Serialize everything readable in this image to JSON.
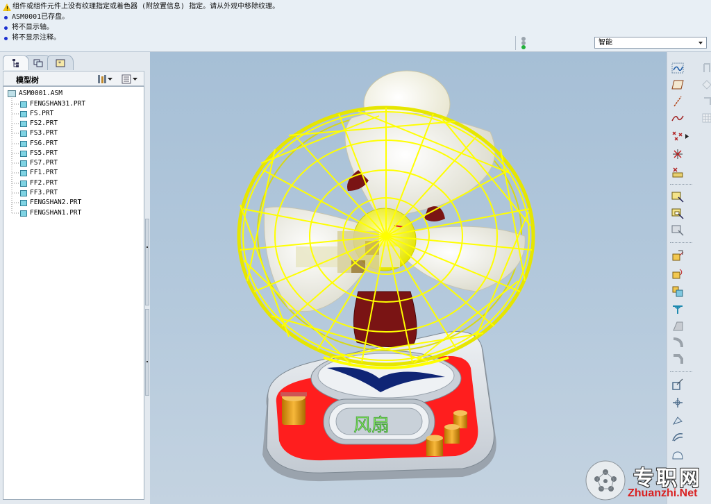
{
  "messages": [
    {
      "type": "warning",
      "text": "组件或组件元件上没有纹理指定或着色器 (附放置信息) 指定。请从外观中移除纹理。"
    },
    {
      "type": "info",
      "text": "ASM0001已存盘。"
    },
    {
      "type": "info",
      "text": "将不显示轴。"
    },
    {
      "type": "info",
      "text": "将不显示注释。"
    }
  ],
  "filter": {
    "selected": "智能"
  },
  "model_tree": {
    "title": "模型树",
    "root": "ASM0001.ASM",
    "items": [
      "FENGSHAN31.PRT",
      "FS.PRT",
      "FS2.PRT",
      "FS3.PRT",
      "FS6.PRT",
      "FS5.PRT",
      "FS7.PRT",
      "FF1.PRT",
      "FF2.PRT",
      "FF3.PRT",
      "FENGSHAN2.PRT",
      "FENGSHAN1.PRT"
    ]
  },
  "model": {
    "base_label": "风扇"
  },
  "watermark": {
    "cn": "专职网",
    "en": "Zhuanzhi.Net"
  },
  "colors": {
    "guard": "#ffff00",
    "blades": "#f1f0e4",
    "stand": "#7a1414",
    "base_red": "#ff1e1e",
    "base_grey": "#d9dfe5",
    "knobs": "#e0a020",
    "accent": "#1b2fd0"
  }
}
